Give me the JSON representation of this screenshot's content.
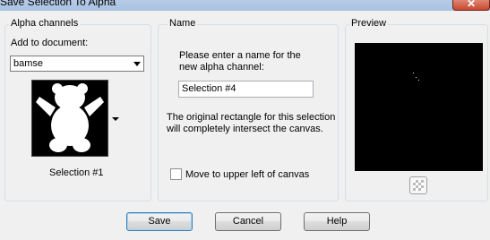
{
  "window": {
    "title": "Save Selection To Alpha",
    "close_glyph": "✕"
  },
  "alpha_channels": {
    "legend": "Alpha channels",
    "add_to_label": "Add to document:",
    "document_selected": "bamse",
    "thumbnail_caption": "Selection #1"
  },
  "name_panel": {
    "legend": "Name",
    "prompt_line1": "Please enter a name for the",
    "prompt_line2": "new alpha channel:",
    "name_value": "Selection #4",
    "info_line1": "The original rectangle for this selection",
    "info_line2": "will completely intersect the canvas.",
    "move_label": "Move to upper left of canvas",
    "move_checked": false
  },
  "preview_panel": {
    "legend": "Preview"
  },
  "buttons": {
    "save": "Save",
    "cancel": "Cancel",
    "help": "Help"
  },
  "colors": {
    "title_bar": "#b6cbe6",
    "default_button_border": "#3c7fb1",
    "preview_bg": "#000000"
  }
}
